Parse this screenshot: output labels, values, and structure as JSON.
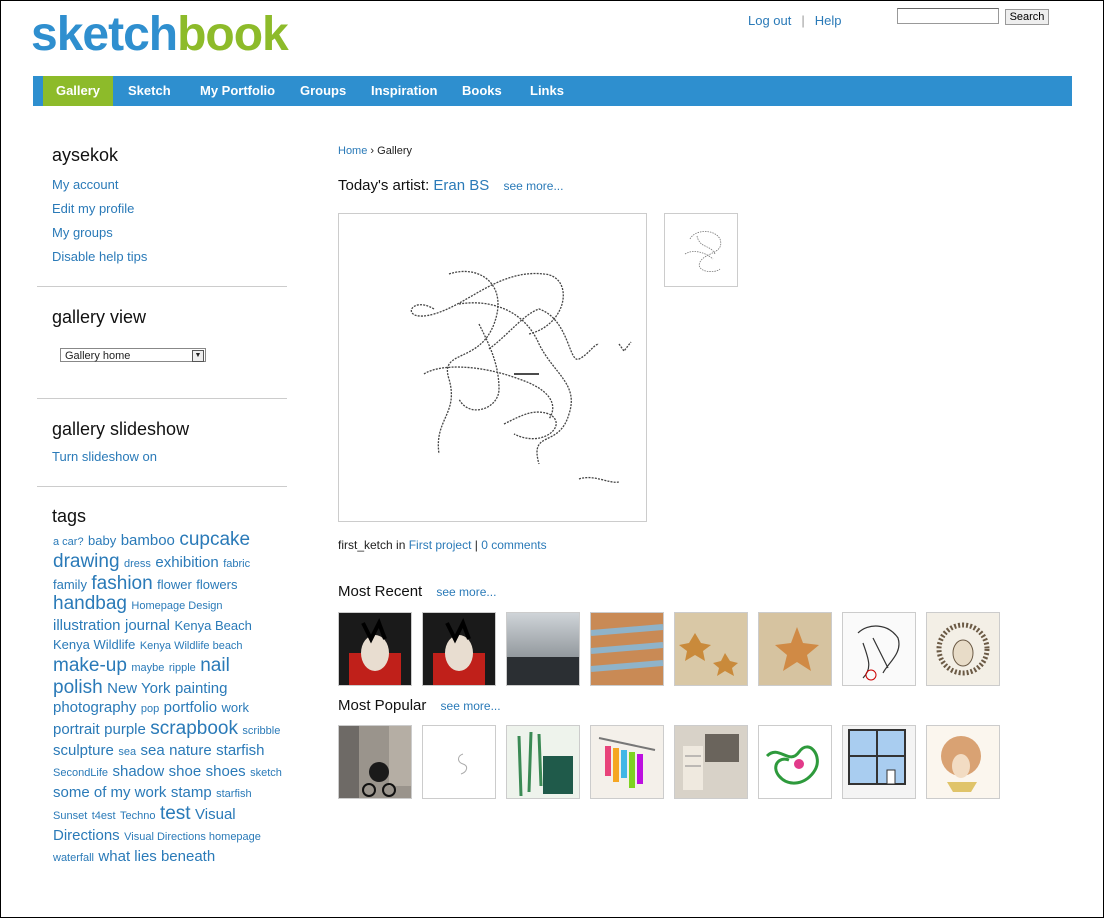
{
  "logo": {
    "part1": "sketch",
    "part2": "book"
  },
  "toplinks": {
    "logout": "Log out",
    "sep": "|",
    "help": "Help"
  },
  "search": {
    "placeholder": "",
    "button": "Search"
  },
  "nav": [
    "Gallery",
    "Sketch",
    "My Portfolio",
    "Groups",
    "Inspiration",
    "Books",
    "Links"
  ],
  "sidebar": {
    "username": "aysekok",
    "account_links": [
      "My account",
      "Edit my profile",
      "My groups",
      "Disable help tips"
    ],
    "gallery_view_title": "gallery view",
    "gallery_view_selected": "Gallery home",
    "slideshow_title": "gallery slideshow",
    "slideshow_link": "Turn slideshow on",
    "tags_title": "tags"
  },
  "tags": [
    {
      "t": "a car?",
      "s": 1
    },
    {
      "t": "baby",
      "s": 2
    },
    {
      "t": "bamboo",
      "s": 3
    },
    {
      "t": "cupcake",
      "s": 4
    },
    {
      "t": "drawing",
      "s": 4
    },
    {
      "t": "dress",
      "s": 1
    },
    {
      "t": "exhibition",
      "s": 3
    },
    {
      "t": "fabric",
      "s": 1
    },
    {
      "t": "family",
      "s": 2
    },
    {
      "t": "fashion",
      "s": 4
    },
    {
      "t": "flower",
      "s": 2
    },
    {
      "t": "flowers",
      "s": 2
    },
    {
      "t": "handbag",
      "s": 4
    },
    {
      "t": "Homepage Design",
      "s": 1
    },
    {
      "t": "illustration",
      "s": 3
    },
    {
      "t": "journal",
      "s": 3
    },
    {
      "t": "Kenya Beach",
      "s": 2
    },
    {
      "t": "Kenya Wildlife",
      "s": 2
    },
    {
      "t": "Kenya Wildlife beach",
      "s": 1
    },
    {
      "t": "make-up",
      "s": 4
    },
    {
      "t": "maybe",
      "s": 1
    },
    {
      "t": "ripple",
      "s": 1
    },
    {
      "t": "nail",
      "s": 4
    },
    {
      "t": "polish",
      "s": 4
    },
    {
      "t": "New York",
      "s": 3
    },
    {
      "t": "painting",
      "s": 3
    },
    {
      "t": "photography",
      "s": 3
    },
    {
      "t": "pop",
      "s": 1
    },
    {
      "t": "portfolio",
      "s": 3
    },
    {
      "t": "work",
      "s": 2
    },
    {
      "t": "portrait",
      "s": 3
    },
    {
      "t": "purple",
      "s": 3
    },
    {
      "t": "scrapbook",
      "s": 4
    },
    {
      "t": "scribble",
      "s": 1
    },
    {
      "t": "sculpture",
      "s": 3
    },
    {
      "t": "sea",
      "s": 1
    },
    {
      "t": "sea",
      "s": 3
    },
    {
      "t": "nature",
      "s": 3
    },
    {
      "t": "starfish",
      "s": 3
    },
    {
      "t": "SecondLife",
      "s": 1
    },
    {
      "t": "shadow",
      "s": 3
    },
    {
      "t": "shoe",
      "s": 3
    },
    {
      "t": "shoes",
      "s": 3
    },
    {
      "t": "sketch",
      "s": 1
    },
    {
      "t": "some of my work",
      "s": 3
    },
    {
      "t": "stamp",
      "s": 3
    },
    {
      "t": "starfish",
      "s": 1
    },
    {
      "t": "Sunset",
      "s": 1
    },
    {
      "t": "t4est",
      "s": 1
    },
    {
      "t": "Techno",
      "s": 1
    },
    {
      "t": "test",
      "s": 4
    },
    {
      "t": "Visual",
      "s": 3
    },
    {
      "t": "Directions",
      "s": 3
    },
    {
      "t": "Visual Directions homepage",
      "s": 1
    },
    {
      "t": "waterfall",
      "s": 1
    },
    {
      "t": "what lies beneath",
      "s": 3
    }
  ],
  "main": {
    "breadcrumb_home": "Home",
    "breadcrumb_sep": "›",
    "breadcrumb_current": "Gallery",
    "todays_artist_label": "Today's artist:",
    "todays_artist_name": "Eran BS",
    "see_more": "see more...",
    "caption_title": "first_ketch",
    "caption_in": "in",
    "caption_project": "First project",
    "caption_sep": "|",
    "caption_comments": "0 comments",
    "most_recent_title": "Most Recent",
    "most_popular_title": "Most Popular"
  },
  "colors": {
    "brand_blue": "#2e8fcf",
    "brand_green": "#8dbb2a",
    "link": "#2a7ab8"
  }
}
